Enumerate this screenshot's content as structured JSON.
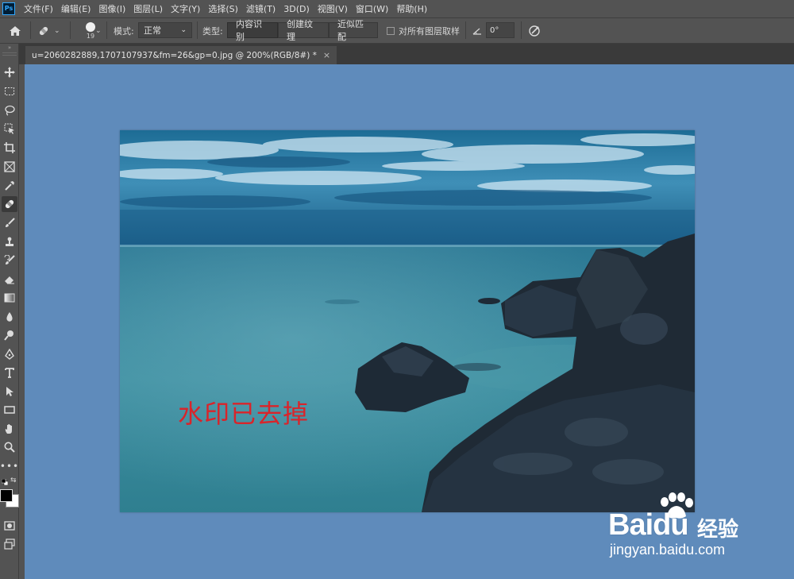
{
  "app": {
    "logo": "Ps"
  },
  "menu": [
    "文件(F)",
    "编辑(E)",
    "图像(I)",
    "图层(L)",
    "文字(Y)",
    "选择(S)",
    "滤镜(T)",
    "3D(D)",
    "视图(V)",
    "窗口(W)",
    "帮助(H)"
  ],
  "options": {
    "brush_size": "19",
    "mode_label": "模式:",
    "mode_value": "正常",
    "type_label": "类型:",
    "type_buttons": [
      "内容识别",
      "创建纹理",
      "近似匹配"
    ],
    "type_active": "内容识别",
    "sample_all_label": "对所有图层取样",
    "sample_all_checked": false,
    "angle_value": "0°"
  },
  "document": {
    "tab_title": "u=2060282889,1707107937&fm=26&gp=0.jpg @ 200%(RGB/8#) *",
    "close": "×"
  },
  "canvas": {
    "overlay_text": "水印已去掉",
    "overlay_color": "#d9242a",
    "background_color": "#5f8bbb"
  },
  "watermark": {
    "brand": "Baidu",
    "cn": "经验",
    "url": "jingyan.baidu.com"
  },
  "tools": [
    "move-tool-icon",
    "marquee-tool-icon",
    "lasso-tool-icon",
    "object-select-tool-icon",
    "crop-tool-icon",
    "frame-tool-icon",
    "eyedropper-tool-icon",
    "healing-brush-tool-icon",
    "brush-tool-icon",
    "clone-stamp-tool-icon",
    "history-brush-tool-icon",
    "eraser-tool-icon",
    "gradient-tool-icon",
    "blur-tool-icon",
    "dodge-tool-icon",
    "pen-tool-icon",
    "type-tool-icon",
    "path-select-tool-icon",
    "rectangle-tool-icon",
    "hand-tool-icon",
    "zoom-tool-icon",
    "more-tools-icon"
  ],
  "colors": {
    "foreground": "#000000",
    "background": "#ffffff"
  }
}
